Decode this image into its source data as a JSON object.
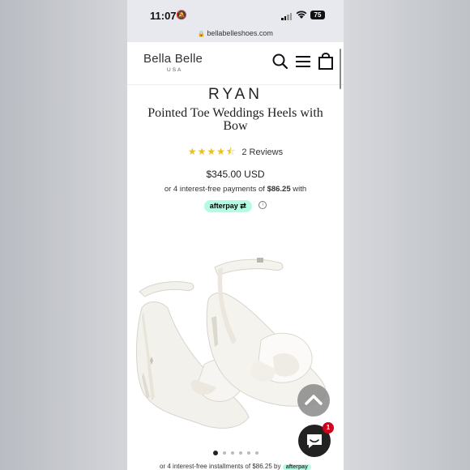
{
  "status_bar": {
    "time": "11:07",
    "battery": "75"
  },
  "browser": {
    "url": "bellabelleshoes.com"
  },
  "header": {
    "logo": "Bella Belle",
    "logo_sub": "USA"
  },
  "product": {
    "brand": "RYAN",
    "title": "Pointed Toe Weddings Heels with Bow",
    "rating_value": 4.5,
    "rating_stars": "★★★★⯪",
    "reviews": "2 Reviews",
    "price": "$345.00 USD",
    "installments_prefix": "or 4 interest-free payments of",
    "installments_amount": "$86.25",
    "installments_suffix": "with",
    "afterpay_label": "afterpay",
    "info_symbol": "i"
  },
  "carousel": {
    "count": 6,
    "active_index": 0
  },
  "chat": {
    "badge_count": "1"
  },
  "bottom_bar": {
    "text": "or 4 interest-free installments of $86.25 by",
    "afterpay_label": "afterpay"
  }
}
